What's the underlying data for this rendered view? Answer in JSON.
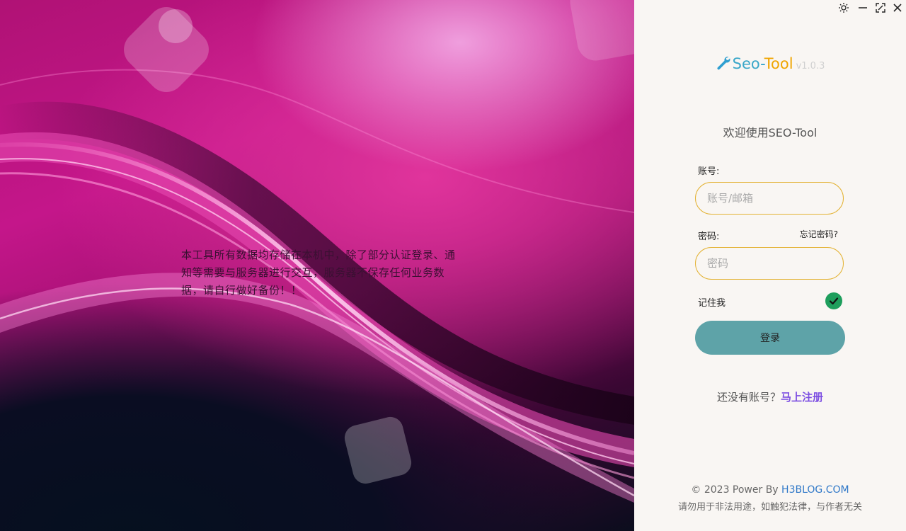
{
  "window": {
    "theme_icon": "sun-icon",
    "minimize_icon": "minimize-icon",
    "maximize_icon": "maximize-icon",
    "close_icon": "close-icon"
  },
  "hero": {
    "notice": "本工具所有数据均存储在本机中，除了部分认证登录、通知等需要与服务器进行交互，服务器不保存任何业务数据，请自行做好备份！！"
  },
  "brand": {
    "icon": "wrench-icon",
    "seo": "Seo",
    "dash": "-",
    "tool": "Tool",
    "version": "v1.0.3"
  },
  "login": {
    "welcome": "欢迎使用SEO-Tool",
    "account_label": "账号:",
    "account_placeholder": "账号/邮箱",
    "account_value": "",
    "password_label": "密码:",
    "forgot_link": "忘记密码?",
    "password_placeholder": "密码",
    "password_value": "",
    "remember_label": "记住我",
    "remember_checked": true,
    "submit_label": "登录",
    "register_prompt": "还没有账号？",
    "register_link": "马上注册"
  },
  "footer": {
    "copyright_prefix": "© 2023 Power By ",
    "site_link": "H3BLOG.COM",
    "disclaimer": "请勿用于非法用途，如触犯法律，与作者无关"
  },
  "colors": {
    "panel_bg": "#f9f6f3",
    "field_border": "#e3b233",
    "login_button": "#5ea3a8",
    "check_green": "#1e9e5c",
    "register_link": "#7d4fe2",
    "footer_link": "#2f78c8",
    "brand_blue": "#3aa7c9",
    "brand_orange": "#f0a500"
  }
}
